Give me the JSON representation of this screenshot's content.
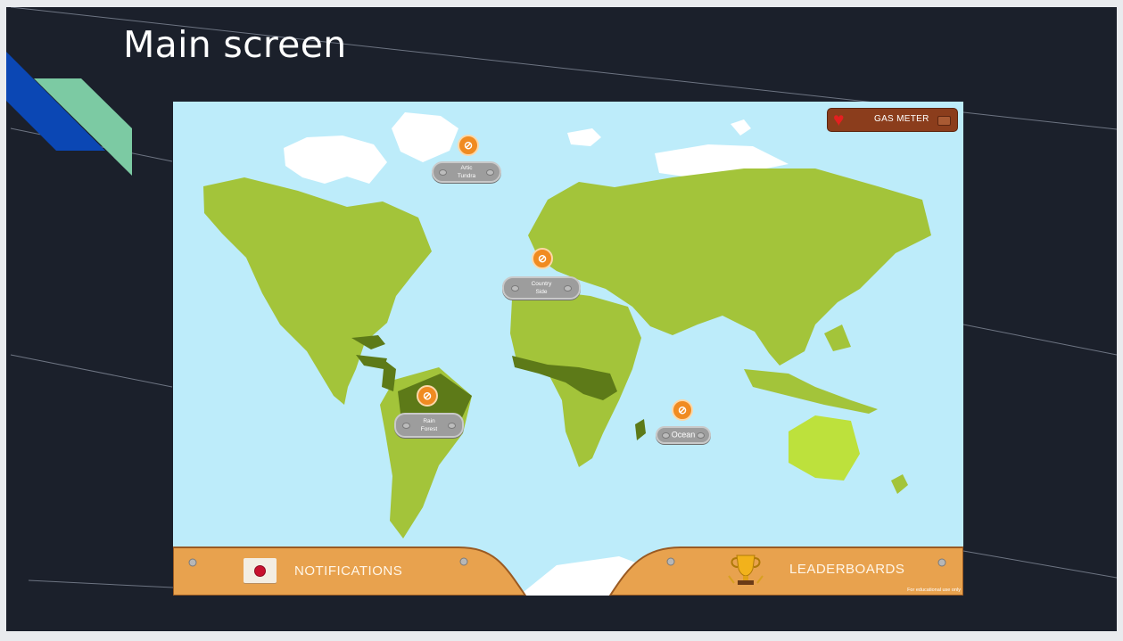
{
  "slide": {
    "title": "Main screen"
  },
  "game": {
    "gas_meter": {
      "label": "GAS METER",
      "icon": "heart-icon"
    },
    "locations": [
      {
        "id": "arctic",
        "label": "Artic\nTundra",
        "icon": "compass-icon"
      },
      {
        "id": "country",
        "label": "Country\nSide",
        "icon": "compass-icon"
      },
      {
        "id": "rainforest",
        "label": "Rain\nForest",
        "icon": "compass-icon"
      },
      {
        "id": "ocean",
        "label": "Ocean",
        "icon": "compass-icon"
      }
    ],
    "bottom_nav": {
      "notifications_label": "NOTIFICATIONS",
      "notifications_icon": "envelope-icon",
      "leaderboards_label": "LEADERBOARDS",
      "leaderboards_icon": "trophy-icon"
    },
    "footnote": "For educational use only"
  },
  "colors": {
    "slide_background": "#1b202b",
    "ocean": "#bdecfa",
    "land": "#a3c43a",
    "forest": "#5d7a18",
    "ice": "#ffffff",
    "wood": "#e8a24e",
    "pin": "#f08b21"
  }
}
